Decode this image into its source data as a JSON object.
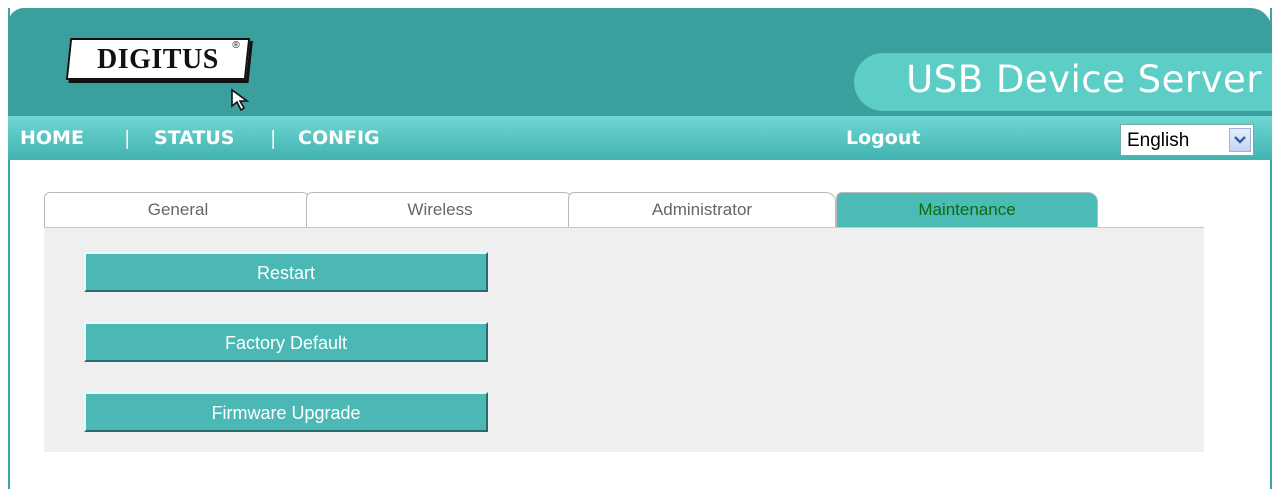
{
  "header": {
    "logo_text": "DIGITUS",
    "logo_mark": "®",
    "title": "USB Device Server"
  },
  "nav": {
    "home": "HOME",
    "separator": "|",
    "status": "STATUS",
    "config": "CONFIG",
    "logout": "Logout"
  },
  "language": {
    "selected": "English",
    "icon": "chevron-down-icon"
  },
  "tabs": [
    {
      "label": "General",
      "active": false
    },
    {
      "label": "Wireless",
      "active": false
    },
    {
      "label": "Administrator",
      "active": false
    },
    {
      "label": "Maintenance",
      "active": true
    }
  ],
  "actions": {
    "restart": "Restart",
    "factory_default": "Factory Default",
    "firmware_upgrade": "Firmware Upgrade"
  },
  "colors": {
    "header_bg": "#3a9f9d",
    "nav_bg": "#41b3b1",
    "accent": "#4cb8b5",
    "active_tab_text": "#0d6a0d"
  }
}
